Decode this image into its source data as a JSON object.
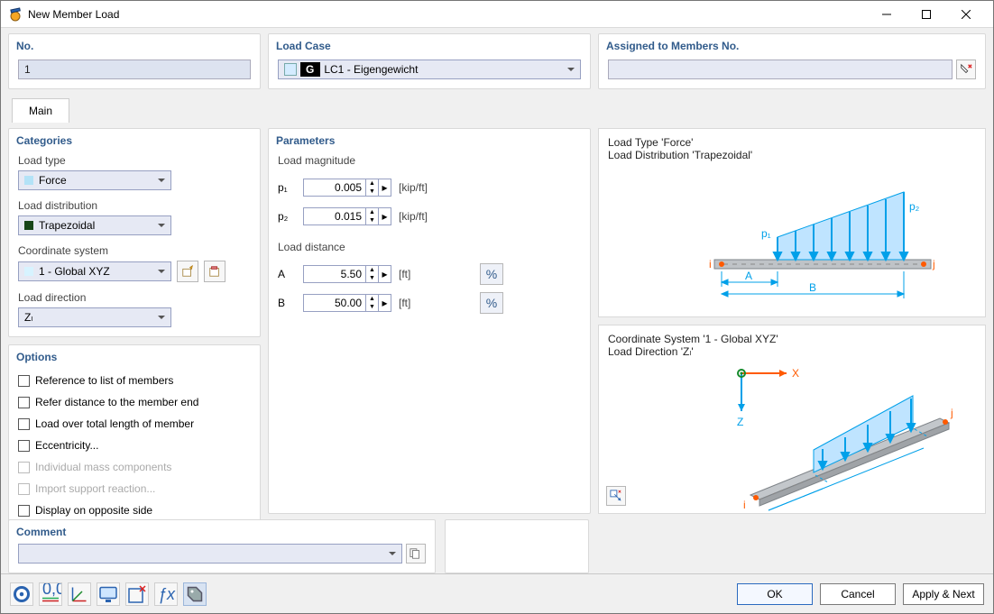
{
  "window": {
    "title": "New Member Load"
  },
  "header": {
    "no_label": "No.",
    "no_value": "1",
    "loadcase_label": "Load Case",
    "loadcase_badge": "G",
    "loadcase_value": "LC1 - Eigengewicht",
    "assigned_label": "Assigned to Members No.",
    "assigned_value": ""
  },
  "tabs": {
    "main": "Main"
  },
  "categories": {
    "title": "Categories",
    "load_type_label": "Load type",
    "load_type_value": "Force",
    "load_dist_label": "Load distribution",
    "load_dist_value": "Trapezoidal",
    "coord_label": "Coordinate system",
    "coord_value": "1 - Global XYZ",
    "load_dir_label": "Load direction",
    "load_dir_value": "Zₗ"
  },
  "options": {
    "title": "Options",
    "ref_list": "Reference to list of members",
    "ref_end": "Refer distance to the member end",
    "load_total": "Load over total length of member",
    "ecc": "Eccentricity...",
    "indiv_mass": "Individual mass components",
    "import_supp": "Import support reaction...",
    "disp_opp": "Display on opposite side"
  },
  "parameters": {
    "title": "Parameters",
    "load_mag_label": "Load magnitude",
    "p1": {
      "label": "p₁",
      "value": "0.005",
      "unit": "[kip/ft]"
    },
    "p2": {
      "label": "p₂",
      "value": "0.015",
      "unit": "[kip/ft]"
    },
    "load_dist_label": "Load distance",
    "A": {
      "label": "A",
      "value": "5.50",
      "unit": "[ft]"
    },
    "B": {
      "label": "B",
      "value": "50.00",
      "unit": "[ft]"
    }
  },
  "diagrams": {
    "top_line1": "Load Type 'Force'",
    "top_line2": "Load Distribution 'Trapezoidal'",
    "p1": "p₁",
    "p2": "p₂",
    "i": "i",
    "j": "j",
    "A": "A",
    "B": "B",
    "bot_line1": "Coordinate System '1 - Global XYZ'",
    "bot_line2": "Load Direction 'Zₗ'",
    "X": "X",
    "Z": "Z"
  },
  "comment": {
    "title": "Comment",
    "value": ""
  },
  "footer": {
    "ok": "OK",
    "cancel": "Cancel",
    "apply_next": "Apply & Next"
  }
}
